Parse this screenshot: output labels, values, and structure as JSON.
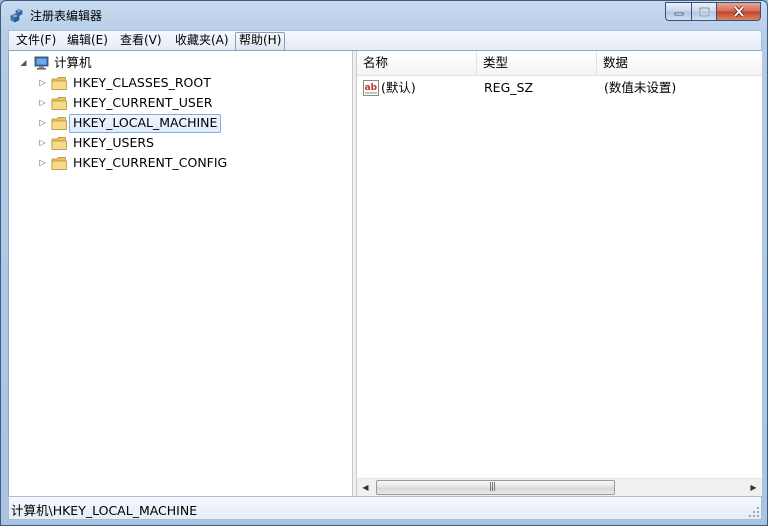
{
  "window": {
    "title": "注册表编辑器",
    "icons": {
      "app": "regedit-cubes-icon",
      "minimize": "minimize-icon",
      "maximize": "maximize-icon",
      "close": "close-icon"
    },
    "colors": {
      "frame": "#a9c3e2",
      "close_button": "#c2432a",
      "selection_border": "#84acdd"
    }
  },
  "menu": {
    "items": [
      {
        "label": "文件(F)"
      },
      {
        "label": "编辑(E)"
      },
      {
        "label": "查看(V)"
      },
      {
        "label": "收藏夹(A)"
      },
      {
        "label": "帮助(H)",
        "active": true
      }
    ]
  },
  "tree": {
    "root": {
      "label": "计算机",
      "icon": "computer-icon",
      "expanded": true
    },
    "items": [
      {
        "label": "HKEY_CLASSES_ROOT",
        "icon": "folder-icon"
      },
      {
        "label": "HKEY_CURRENT_USER",
        "icon": "folder-icon"
      },
      {
        "label": "HKEY_LOCAL_MACHINE",
        "icon": "folder-icon",
        "selected": true
      },
      {
        "label": "HKEY_USERS",
        "icon": "folder-icon"
      },
      {
        "label": "HKEY_CURRENT_CONFIG",
        "icon": "folder-icon"
      }
    ]
  },
  "list": {
    "columns": [
      "名称",
      "类型",
      "数据"
    ],
    "rows": [
      {
        "name": "(默认)",
        "type": "REG_SZ",
        "data": "(数值未设置)",
        "icon": "string-value-ab-icon"
      }
    ]
  },
  "status": {
    "path": "计算机\\HKEY_LOCAL_MACHINE"
  }
}
